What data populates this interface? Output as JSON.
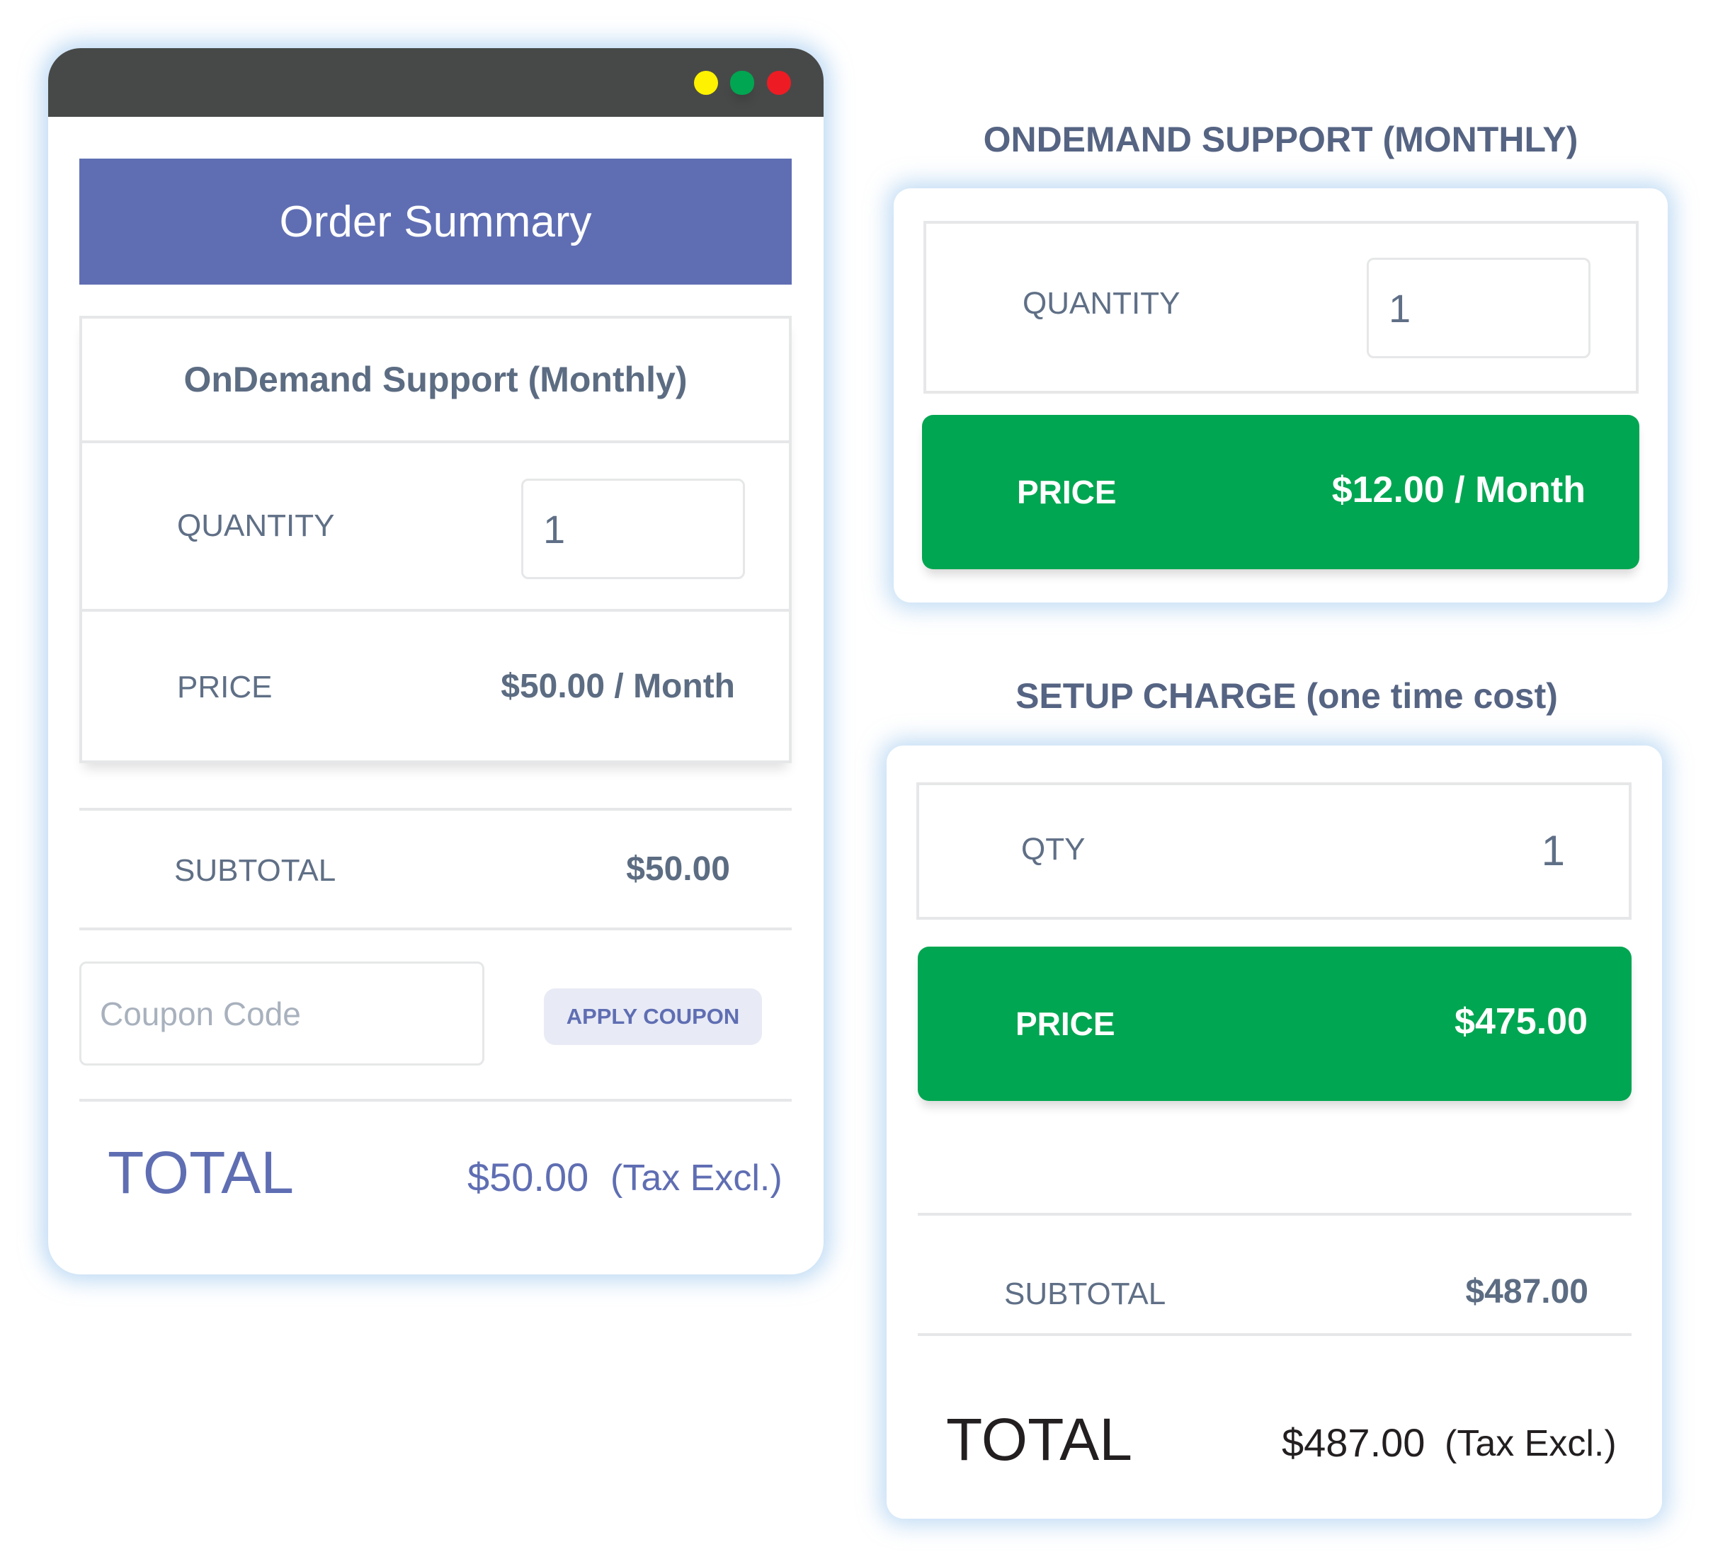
{
  "window": {
    "controls": [
      {
        "name": "minimize",
        "color": "#fff200"
      },
      {
        "name": "maximize",
        "color": "#00a651"
      },
      {
        "name": "close",
        "color": "#ed1c24"
      }
    ]
  },
  "order_summary": {
    "title": "Order Summary",
    "item_name": "OnDemand Support (Monthly)",
    "quantity_label": "QUANTITY",
    "quantity_value": "1",
    "price_label": "PRICE",
    "price_value": "$50.00 / Month",
    "subtotal_label": "SUBTOTAL",
    "subtotal_value": "$50.00",
    "coupon_placeholder": "Coupon Code",
    "apply_coupon_label": "APPLY COUPON",
    "total_label": "TOTAL",
    "total_value": "$50.00",
    "tax_note": "(Tax Excl.)"
  },
  "ondemand_card": {
    "heading": "ONDEMAND SUPPORT (MONTHLY)",
    "quantity_label": "QUANTITY",
    "quantity_value": "1",
    "price_label": "PRICE",
    "price_value": "$12.00 / Month"
  },
  "setup_card": {
    "heading": "SETUP CHARGE (one time cost)",
    "qty_label": "QTY",
    "qty_value": "1",
    "price_label": "PRICE",
    "price_value": "$475.00",
    "subtotal_label": "SUBTOTAL",
    "subtotal_value": "$487.00",
    "total_label": "TOTAL",
    "total_value": "$487.00",
    "tax_note": "(Tax Excl.)"
  },
  "colors": {
    "header_blue": "#5f6eb3",
    "price_green": "#00a651",
    "title_bar": "#474948",
    "text_slate": "#5f6f86"
  }
}
